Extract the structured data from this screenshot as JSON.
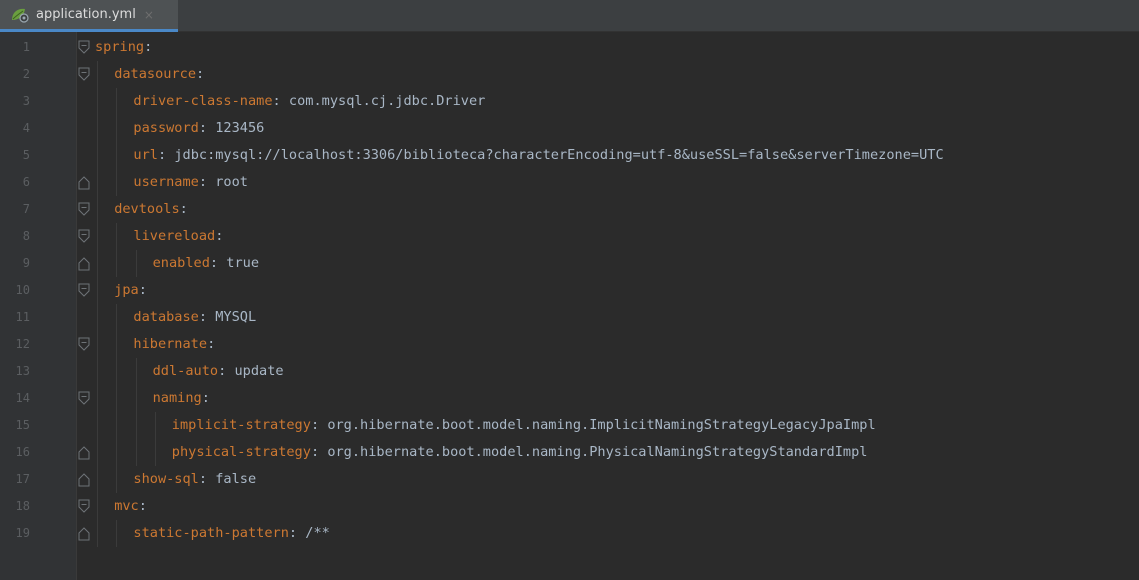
{
  "tab": {
    "label": "application.yml",
    "close_glyph": "×",
    "icon": "spring-leaf-icon"
  },
  "colors": {
    "key": "#cc7832",
    "value": "#a9b7c6",
    "background": "#2b2b2b",
    "gutter": "#313335",
    "tab_active_underline": "#4a88c7"
  },
  "lines": [
    {
      "num": "1",
      "indent": 0,
      "key": "spring",
      "value": "",
      "fold": "open"
    },
    {
      "num": "2",
      "indent": 1,
      "key": "datasource",
      "value": "",
      "fold": "open"
    },
    {
      "num": "3",
      "indent": 2,
      "key": "driver-class-name",
      "value": "com.mysql.cj.jdbc.Driver",
      "fold": ""
    },
    {
      "num": "4",
      "indent": 2,
      "key": "password",
      "value": "123456",
      "fold": ""
    },
    {
      "num": "5",
      "indent": 2,
      "key": "url",
      "value": "jdbc:mysql://localhost:3306/biblioteca?characterEncoding=utf-8&useSSL=false&serverTimezone=UTC",
      "fold": ""
    },
    {
      "num": "6",
      "indent": 2,
      "key": "username",
      "value": "root",
      "fold": "close"
    },
    {
      "num": "7",
      "indent": 1,
      "key": "devtools",
      "value": "",
      "fold": "open"
    },
    {
      "num": "8",
      "indent": 2,
      "key": "livereload",
      "value": "",
      "fold": "open"
    },
    {
      "num": "9",
      "indent": 3,
      "key": "enabled",
      "value": "true",
      "fold": "close"
    },
    {
      "num": "10",
      "indent": 1,
      "key": "jpa",
      "value": "",
      "fold": "open"
    },
    {
      "num": "11",
      "indent": 2,
      "key": "database",
      "value": "MYSQL",
      "fold": ""
    },
    {
      "num": "12",
      "indent": 2,
      "key": "hibernate",
      "value": "",
      "fold": "open"
    },
    {
      "num": "13",
      "indent": 3,
      "key": "ddl-auto",
      "value": "update",
      "fold": ""
    },
    {
      "num": "14",
      "indent": 3,
      "key": "naming",
      "value": "",
      "fold": "open"
    },
    {
      "num": "15",
      "indent": 4,
      "key": "implicit-strategy",
      "value": "org.hibernate.boot.model.naming.ImplicitNamingStrategyLegacyJpaImpl",
      "fold": ""
    },
    {
      "num": "16",
      "indent": 4,
      "key": "physical-strategy",
      "value": "org.hibernate.boot.model.naming.PhysicalNamingStrategyStandardImpl",
      "fold": "close"
    },
    {
      "num": "17",
      "indent": 2,
      "key": "show-sql",
      "value": "false",
      "fold": "close"
    },
    {
      "num": "18",
      "indent": 1,
      "key": "mvc",
      "value": "",
      "fold": "open"
    },
    {
      "num": "19",
      "indent": 2,
      "key": "static-path-pattern",
      "value": "/**",
      "fold": "close"
    }
  ]
}
